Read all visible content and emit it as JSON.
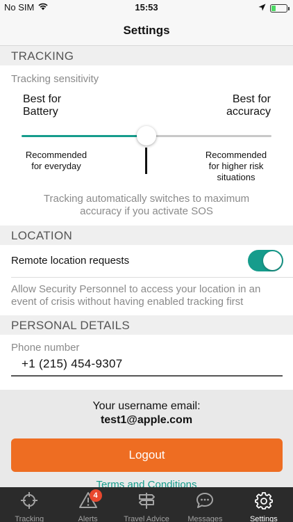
{
  "status_bar": {
    "carrier": "No SIM",
    "time": "15:53"
  },
  "nav": {
    "title": "Settings"
  },
  "tracking": {
    "header": "TRACKING",
    "sensitivity_label": "Tracking sensitivity",
    "left_title": "Best for\nBattery",
    "right_title": "Best for\naccuracy",
    "left_note": "Recommended\nfor everyday",
    "right_note": "Recommended\nfor higher risk\nsituations",
    "slider_value": 0.5,
    "info": "Tracking automatically switches to maximum accuracy if you activate SOS"
  },
  "location": {
    "header": "LOCATION",
    "remote_label": "Remote location requests",
    "remote_enabled": true,
    "description": "Allow Security Personnel to access your location in an event of crisis without having enabled tracking first"
  },
  "personal": {
    "header": "PERSONAL DETAILS",
    "phone_label": "Phone number",
    "phone_value": "+1 (215) 454-9307"
  },
  "account": {
    "username_label": "Your username email:",
    "username_email": "test1@apple.com",
    "logout_label": "Logout",
    "terms_label": "Terms and Conditions"
  },
  "tabs": [
    {
      "label": "Tracking",
      "icon": "crosshair-icon"
    },
    {
      "label": "Alerts",
      "icon": "warning-icon",
      "badge": "4"
    },
    {
      "label": "Travel Advice",
      "icon": "signpost-icon"
    },
    {
      "label": "Messages",
      "icon": "chat-bubble-icon"
    },
    {
      "label": "Settings",
      "icon": "gear-icon",
      "active": true
    }
  ],
  "colors": {
    "accent": "#169c8c",
    "logout": "#ee6d22",
    "tab_bar": "#2b2b2b",
    "badge": "#e8482e"
  }
}
